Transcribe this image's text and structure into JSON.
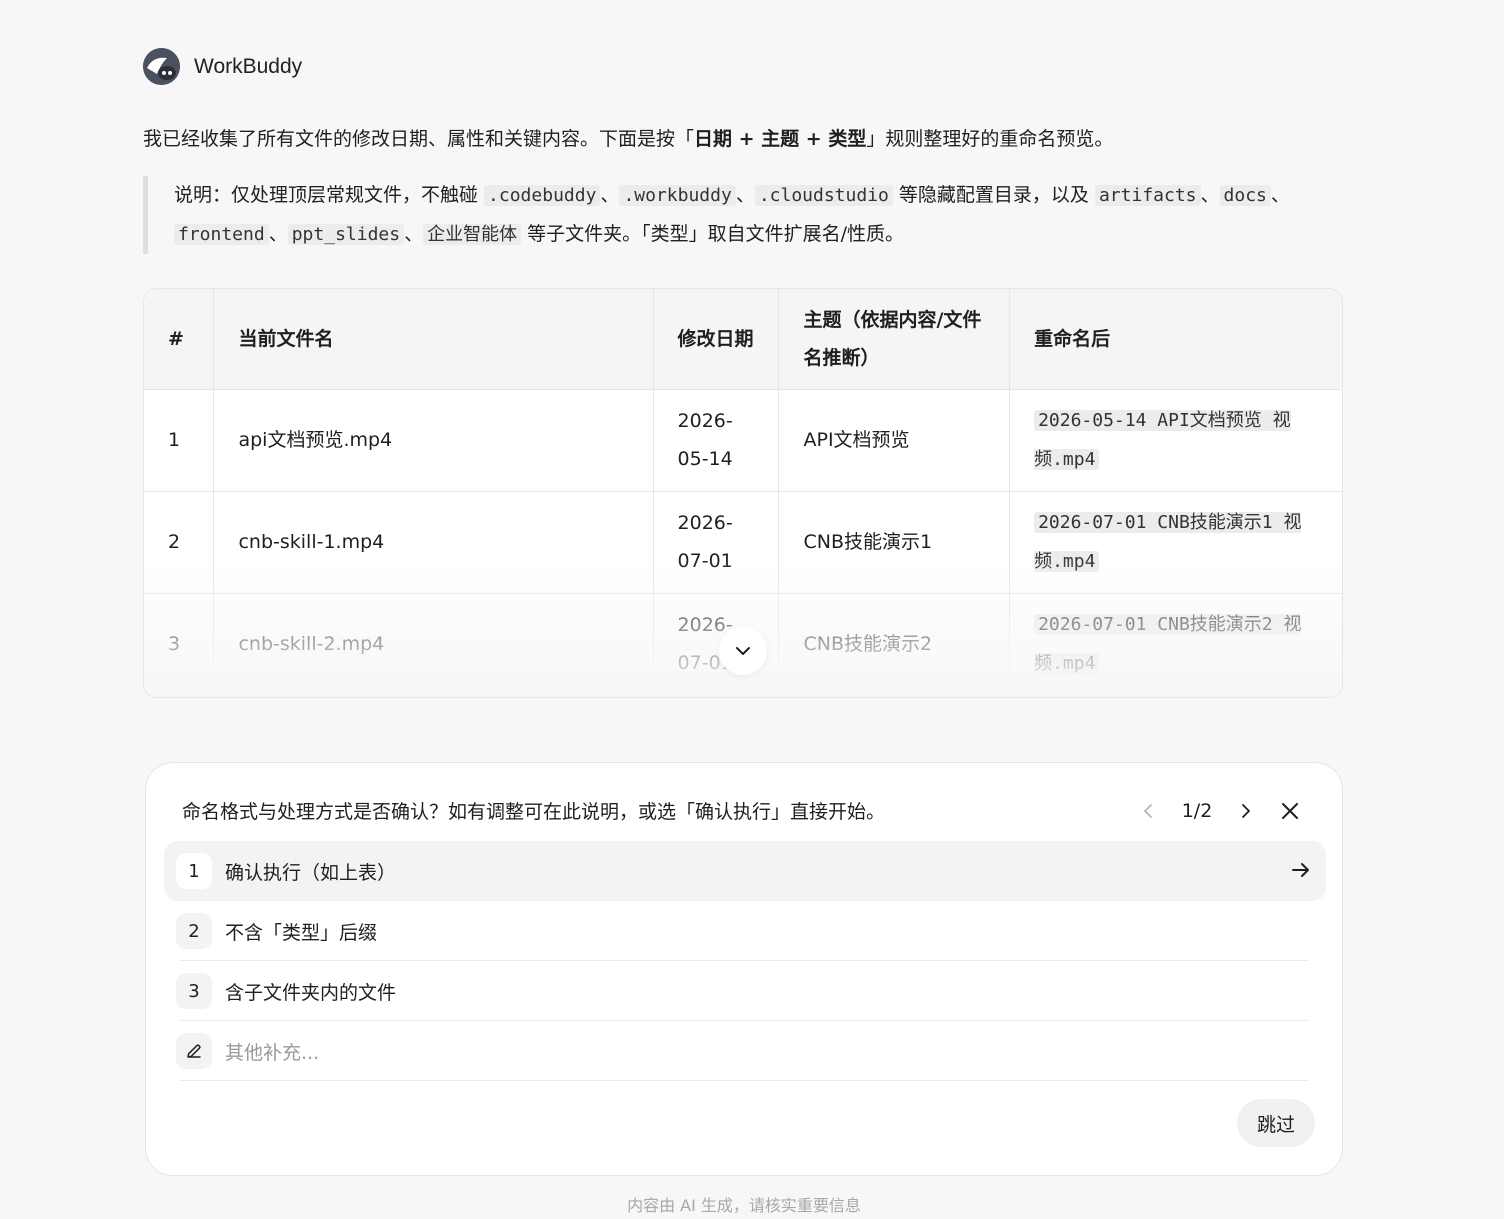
{
  "app": {
    "name": "WorkBuddy"
  },
  "intro": {
    "prefix": "我已经收集了所有文件的修改日期、属性和关键内容。下面是按「",
    "rule": "日期 + 主题 + 类型",
    "suffix": "」规则整理好的重命名预览。"
  },
  "note": {
    "t1": "说明：仅处理顶层常规文件，不触碰 ",
    "c1": ".codebuddy",
    "s1": "、",
    "c2": ".workbuddy",
    "s2": "、",
    "c3": ".cloudstudio",
    "t2": " 等隐藏配置目录，以及 ",
    "c4": "artifacts",
    "s3": "、",
    "c5": "docs",
    "s4": "、",
    "c6": "frontend",
    "s5": "、",
    "c7": "ppt_slides",
    "s6": "、",
    "c8": "企业智能体",
    "t3": " 等子文件夹。「类型」取自文件扩展名/性质。"
  },
  "table": {
    "headers": [
      "#",
      "当前文件名",
      "修改日期",
      "主题（依据内容/文件名推断）",
      "重命名后"
    ],
    "rows": [
      {
        "no": "1",
        "current": "api文档预览.mp4",
        "date": "2026-05-14",
        "topic": "API文档预览",
        "renamed": "2026-05-14 API文档预览 视频.mp4"
      },
      {
        "no": "2",
        "current": "cnb-skill-1.mp4",
        "date": "2026-07-01",
        "topic": "CNB技能演示1",
        "renamed": "2026-07-01 CNB技能演示1 视频.mp4"
      },
      {
        "no": "3",
        "current": "cnb-skill-2.mp4",
        "date": "2026-07-01",
        "topic": "CNB技能演示2",
        "renamed": "2026-07-01 CNB技能演示2 视频.mp4"
      }
    ]
  },
  "panel": {
    "question": "命名格式与处理方式是否确认？如有调整可在此说明，或选「确认执行」直接开始。",
    "page": "1/2",
    "options": [
      {
        "num": "1",
        "label": "确认执行（如上表）"
      },
      {
        "num": "2",
        "label": "不含「类型」后缀"
      },
      {
        "num": "3",
        "label": "含子文件夹内的文件"
      }
    ],
    "other_placeholder": "其他补充...",
    "skip_label": "跳过"
  },
  "footer": {
    "text": "内容由 AI 生成，请核实重要信息"
  }
}
